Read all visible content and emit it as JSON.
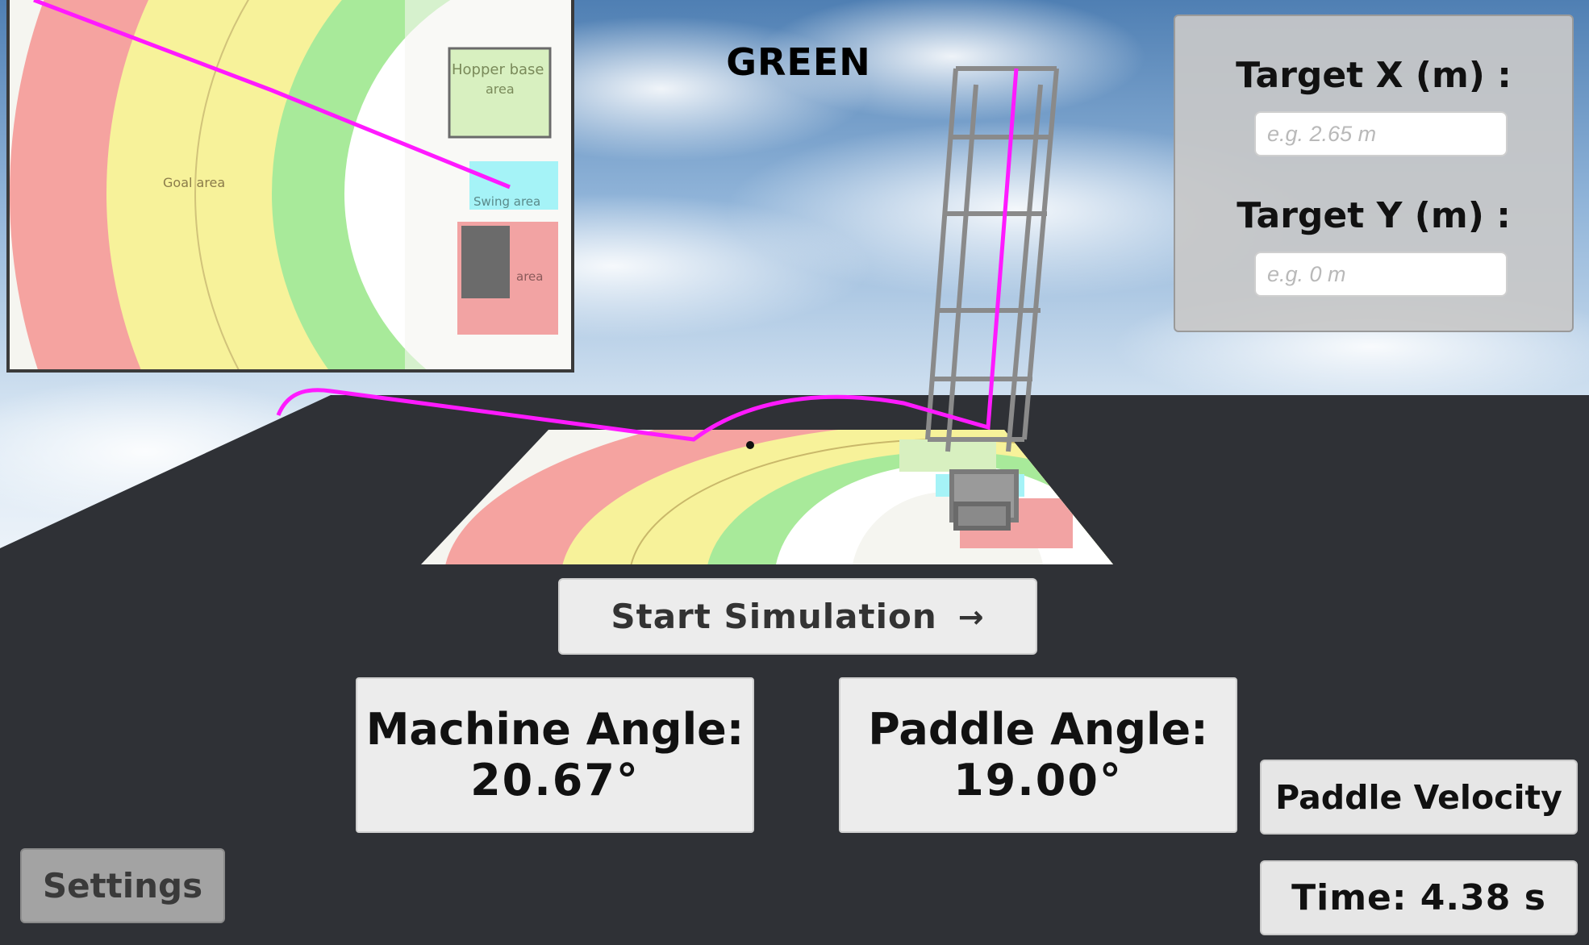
{
  "hud": {
    "team_color_label": "GREEN"
  },
  "target_panel": {
    "x_label": "Target X (m) :",
    "x_placeholder": "e.g. 2.65 m",
    "x_value": "",
    "y_label": "Target Y (m) :",
    "y_placeholder": "e.g. 0 m",
    "y_value": ""
  },
  "controls": {
    "start_label": "Start Simulation",
    "start_arrow": "→",
    "settings_label": "Settings",
    "velocity_label": "Paddle Velocity"
  },
  "readouts": {
    "machine_angle_label": "Machine Angle:",
    "machine_angle_value": "20.67°",
    "paddle_angle_label": "Paddle Angle:",
    "paddle_angle_value": "19.00°",
    "time_text": "Time: 4.38 s"
  },
  "minimap": {
    "labels": {
      "goal_area": "Goal area",
      "hopper_base": "Hopper base",
      "hopper_area": "area",
      "swing_area": "Swing area",
      "red_area": "area"
    }
  },
  "colors": {
    "trajectory": "#ff1aff",
    "zone_red": "#f5a3a0",
    "zone_yellow": "#f7f29a",
    "zone_green": "#a8ea9a",
    "zone_white": "#ffffff",
    "swing_area": "#a5f3f7",
    "red_area": "#f2a3a3",
    "floor": "#2f3136",
    "sky_top": "#4a79ad",
    "sky_bottom": "#e8f0f8"
  },
  "icons": {
    "arrow": "right-arrow-icon",
    "ball": "ball-icon"
  }
}
